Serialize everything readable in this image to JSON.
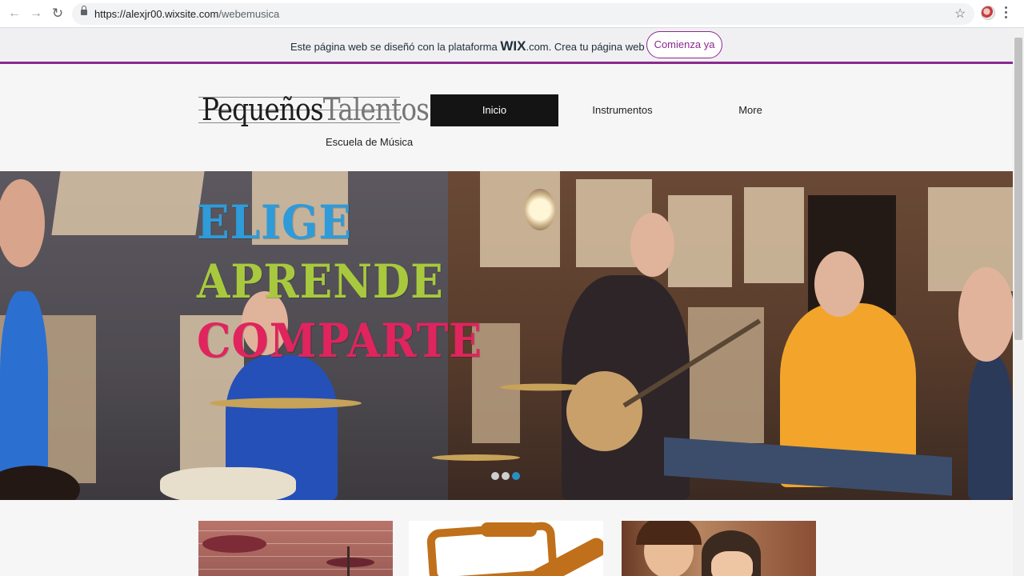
{
  "browser": {
    "url_host": "https://alexjr00.wixsite.com",
    "url_path": "/webemusica",
    "icons": [
      "back-icon",
      "forward-icon",
      "reload-icon",
      "lock-icon",
      "star-icon",
      "profile-avatar",
      "menu-icon"
    ]
  },
  "wix_banner": {
    "text_before": "Este página web se diseñó con la plataforma",
    "brand": "WIX",
    "text_after": ".com. Crea tu página web hoy.",
    "cta_label": "Comienza ya",
    "accent_color": "#8b2a8f"
  },
  "site": {
    "logo_bold": "Pequeños",
    "logo_light": "Talentos",
    "logo_subtitle": "Escuela de Música",
    "nav": [
      {
        "label": "Inicio",
        "active": true
      },
      {
        "label": "Instrumentos",
        "active": false
      },
      {
        "label": "More",
        "active": false
      }
    ]
  },
  "hero": {
    "words": [
      {
        "text": "ELIGE",
        "color": "#2f9bd9"
      },
      {
        "text": "APRENDE",
        "color": "#a8c93e"
      },
      {
        "text": "COMPARTE",
        "color": "#e0245e"
      }
    ],
    "slides_total": 3,
    "slide_current": 3
  },
  "cards": [
    {
      "name": "drums-photo"
    },
    {
      "name": "instruments-illustration"
    },
    {
      "name": "family-photo"
    }
  ]
}
